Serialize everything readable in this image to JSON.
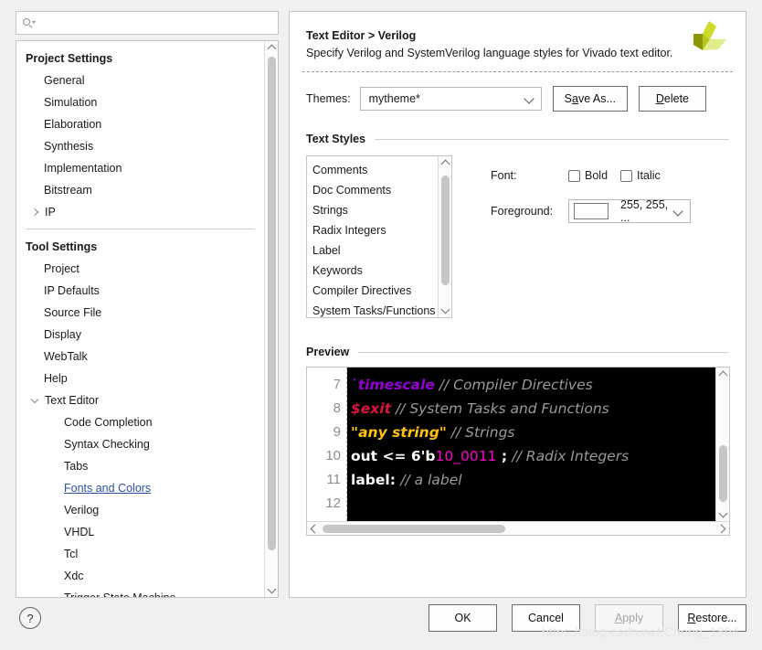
{
  "search": {
    "placeholder": "",
    "value": "",
    "icon": "search-icon"
  },
  "sidebar": {
    "groups": [
      {
        "title": "Project Settings",
        "items": [
          {
            "label": "General",
            "level": 1,
            "arrow": "none"
          },
          {
            "label": "Simulation",
            "level": 1,
            "arrow": "none"
          },
          {
            "label": "Elaboration",
            "level": 1,
            "arrow": "none"
          },
          {
            "label": "Synthesis",
            "level": 1,
            "arrow": "none"
          },
          {
            "label": "Implementation",
            "level": 1,
            "arrow": "none"
          },
          {
            "label": "Bitstream",
            "level": 1,
            "arrow": "none"
          },
          {
            "label": "IP",
            "level": 0,
            "arrow": "right"
          }
        ]
      },
      {
        "title": "Tool Settings",
        "items": [
          {
            "label": "Project",
            "level": 1,
            "arrow": "none"
          },
          {
            "label": "IP Defaults",
            "level": 1,
            "arrow": "none"
          },
          {
            "label": "Source File",
            "level": 1,
            "arrow": "none"
          },
          {
            "label": "Display",
            "level": 1,
            "arrow": "none"
          },
          {
            "label": "WebTalk",
            "level": 1,
            "arrow": "none"
          },
          {
            "label": "Help",
            "level": 1,
            "arrow": "none"
          },
          {
            "label": "Text Editor",
            "level": 0,
            "arrow": "down"
          },
          {
            "label": "Code Completion",
            "level": 2,
            "arrow": "none"
          },
          {
            "label": "Syntax Checking",
            "level": 2,
            "arrow": "none"
          },
          {
            "label": "Tabs",
            "level": 2,
            "arrow": "none"
          },
          {
            "label": "Fonts and Colors",
            "level": 2,
            "arrow": "none",
            "link": true
          },
          {
            "label": "Verilog",
            "level": 2,
            "arrow": "none"
          },
          {
            "label": "VHDL",
            "level": 2,
            "arrow": "none"
          },
          {
            "label": "Tcl",
            "level": 2,
            "arrow": "none"
          },
          {
            "label": "Xdc",
            "level": 2,
            "arrow": "none"
          },
          {
            "label": "Trigger State Machine",
            "level": 2,
            "arrow": "none"
          }
        ]
      }
    ]
  },
  "panel": {
    "title": "Text Editor > Verilog",
    "subtitle": "Specify Verilog and SystemVerilog language styles for Vivado text editor.",
    "logo": "vivado-logo"
  },
  "themes": {
    "label": "Themes:",
    "selected": "mytheme*",
    "options": [
      "mytheme*"
    ],
    "save_as_label": "Save As...",
    "save_as_mnemonic": "a",
    "delete_label": "Delete",
    "delete_mnemonic": "D"
  },
  "text_styles": {
    "section_title": "Text Styles",
    "items": [
      "Comments",
      "Doc Comments",
      "Strings",
      "Radix Integers",
      "Label",
      "Keywords",
      "Compiler Directives",
      "System Tasks/Functions"
    ],
    "font_label": "Font:",
    "bold_label": "Bold",
    "bold_checked": false,
    "italic_label": "Italic",
    "italic_checked": false,
    "foreground_label": "Foreground:",
    "foreground_value": "255, 255, ...",
    "foreground_swatch": "#ffffff"
  },
  "preview": {
    "section_title": "Preview",
    "line_numbers": [
      "7",
      "8",
      "9",
      "10",
      "11",
      "12"
    ],
    "background": "#000000",
    "lines": [
      {
        "tokens": [
          {
            "text": "`timescale",
            "style": "directive"
          },
          {
            "text": " // Compiler Directives",
            "style": "comment"
          }
        ]
      },
      {
        "tokens": [
          {
            "text": "$exit",
            "style": "systask"
          },
          {
            "text": " // System Tasks and Functions",
            "style": "comment"
          }
        ]
      },
      {
        "tokens": [
          {
            "text": "\"any string\"",
            "style": "string"
          },
          {
            "text": " // Strings",
            "style": "comment"
          }
        ]
      },
      {
        "tokens": [
          {
            "text": "out <= 6'b",
            "style": "plain"
          },
          {
            "text": "10_0011",
            "style": "radix"
          },
          {
            "text": " ; ",
            "style": "plain"
          },
          {
            "text": "// Radix Integers",
            "style": "comment"
          }
        ]
      },
      {
        "tokens": [
          {
            "text": "label: ",
            "style": "plain"
          },
          {
            "text": "// a label",
            "style": "comment"
          }
        ]
      },
      {
        "tokens": []
      }
    ],
    "colors": {
      "directive": "#9400d3",
      "systask": "#dc143c",
      "string": "#ffc20e",
      "radix": "#ff00c8",
      "plain": "#ffffff",
      "comment": "#9a9a9a"
    }
  },
  "footer": {
    "help_label": "?",
    "buttons": [
      {
        "label": "OK",
        "enabled": true,
        "mnemonic": ""
      },
      {
        "label": "Cancel",
        "enabled": true,
        "mnemonic": ""
      },
      {
        "label": "Apply",
        "enabled": false,
        "mnemonic": "A"
      },
      {
        "label": "Restore...",
        "enabled": true,
        "mnemonic": "R"
      }
    ]
  },
  "watermark": "https://blog.csdn.net/Cheng_1894"
}
